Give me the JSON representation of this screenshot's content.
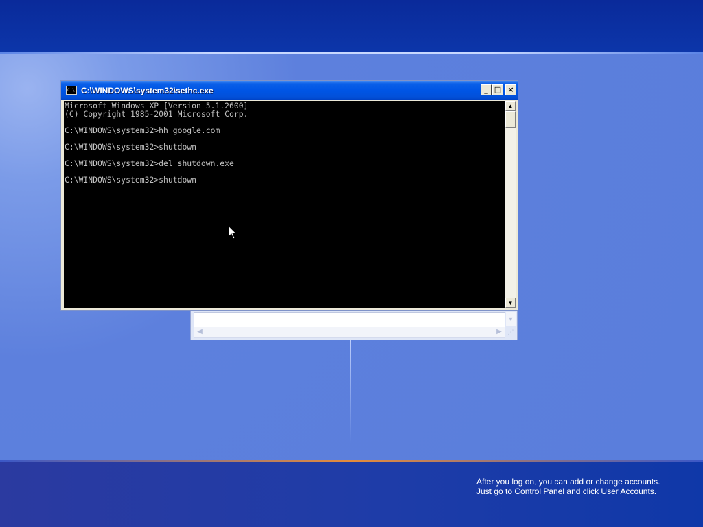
{
  "console": {
    "title": "C:\\WINDOWS\\system32\\sethc.exe",
    "icon": "console-icon",
    "icon_text": "C:\\",
    "buttons": {
      "minimize": "_",
      "maximize": "□",
      "close": "×"
    },
    "lines": [
      "Microsoft Windows XP [Version 5.1.2600]",
      "(C) Copyright 1985-2001 Microsoft Corp.",
      "",
      "C:\\WINDOWS\\system32>hh google.com",
      "",
      "C:\\WINDOWS\\system32>shutdown",
      "",
      "C:\\WINDOWS\\system32>del shutdown.exe",
      "",
      "C:\\WINDOWS\\system32>shutdown"
    ]
  },
  "welcome": {
    "info_line1": "After you log on, you can add or change accounts.",
    "info_line2": "Just go to Control Panel and click User Accounts."
  },
  "colors": {
    "titlebar": "#0055e5",
    "desktop": "#5a7edc",
    "console_bg": "#000000",
    "console_text": "#c0c0c0"
  }
}
